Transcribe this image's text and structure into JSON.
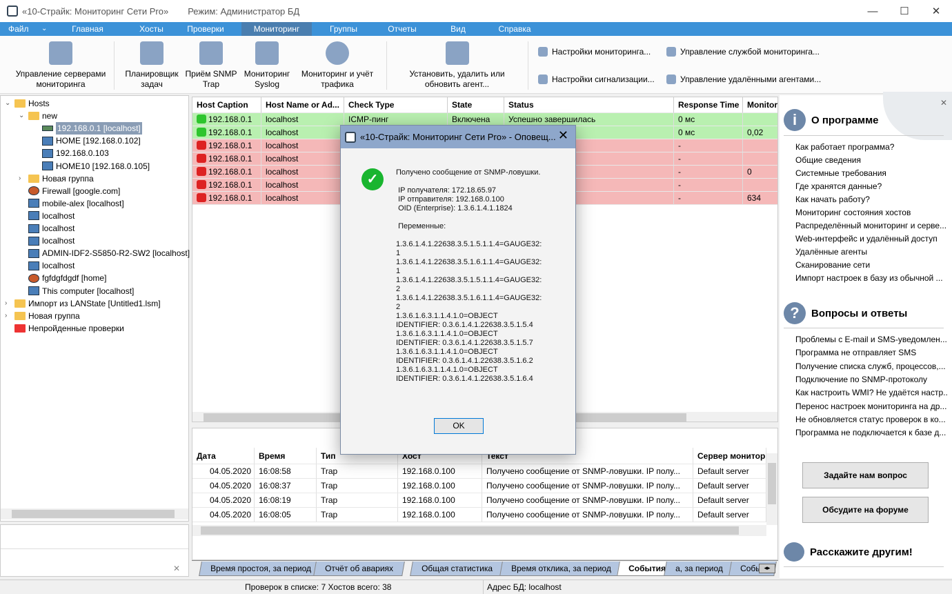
{
  "title": {
    "app": "«10-Страйк: Мониторинг Сети Pro»",
    "mode": "Режим: Администратор БД"
  },
  "menu": [
    "Файл",
    "Главная",
    "Хосты",
    "Проверки",
    "Мониторинг",
    "Группы",
    "Отчеты",
    "Вид",
    "Справка"
  ],
  "menu_active": "Мониторинг",
  "ribbon": {
    "buttons": [
      "Управление серверами мониторинга",
      "Планировщик задач",
      "Приём SNMP Trap",
      "Мониторинг Syslog",
      "Мониторинг и учёт трафика",
      "Установить, удалить или обновить агент..."
    ],
    "small": [
      "Настройки мониторинга...",
      "Настройки сигнализации...",
      "Управление службой мониторинга...",
      "Управление удалёнными агентами..."
    ]
  },
  "tree": [
    {
      "label": "Hosts",
      "level": 0,
      "icon": "folder",
      "exp": "v"
    },
    {
      "label": "new",
      "level": 1,
      "icon": "folder",
      "exp": "v"
    },
    {
      "label": "192.168.0.1 [localhost]",
      "level": 2,
      "icon": "switch",
      "selected": true
    },
    {
      "label": "HOME [192.168.0.102]",
      "level": 2,
      "icon": "computer"
    },
    {
      "label": "192.168.0.103",
      "level": 2,
      "icon": "computer"
    },
    {
      "label": "HOME10 [192.168.0.105]",
      "level": 2,
      "icon": "computer"
    },
    {
      "label": "Новая группа",
      "level": 1,
      "icon": "folder",
      "exp": ">"
    },
    {
      "label": "Firewall [google.com]",
      "level": 1,
      "icon": "firewall"
    },
    {
      "label": "mobile-alex [localhost]",
      "level": 1,
      "icon": "laptop"
    },
    {
      "label": "localhost",
      "level": 1,
      "icon": "computer"
    },
    {
      "label": "localhost",
      "level": 1,
      "icon": "computer"
    },
    {
      "label": "localhost",
      "level": 1,
      "icon": "computer"
    },
    {
      "label": "ADMIN-IDF2-S5850-R2-SW2 [localhost]",
      "level": 1,
      "icon": "computer"
    },
    {
      "label": "localhost",
      "level": 1,
      "icon": "computer"
    },
    {
      "label": "fgfdgfdgdf [home]",
      "level": 1,
      "icon": "firewall"
    },
    {
      "label": "This computer [localhost]",
      "level": 1,
      "icon": "computer"
    },
    {
      "label": "Импорт из LANState [Untitled1.lsm]",
      "level": 0,
      "icon": "folder",
      "exp": ">"
    },
    {
      "label": "Новая группа",
      "level": 0,
      "icon": "folder",
      "exp": ">"
    },
    {
      "label": "Непройденные проверки",
      "level": 0,
      "icon": "folder-red"
    }
  ],
  "grid": {
    "columns": [
      "Host Caption",
      "Host Name or Ad...",
      "Check Type",
      "State",
      "Status",
      "Response Time",
      "Monitor"
    ],
    "rows": [
      {
        "s": "ok",
        "c": [
          "192.168.0.1",
          "localhost",
          "ICMP-пинг",
          "Включена",
          "Успешно завершилась",
          "0 мс",
          ""
        ]
      },
      {
        "s": "ok",
        "c": [
          "192.168.0.1",
          "localhost",
          "",
          "",
          "шилась",
          "0 мс",
          "0,02"
        ]
      },
      {
        "s": "bad",
        "c": [
          "192.168.0.1",
          "localhost",
          "",
          "",
          "",
          "-",
          ""
        ]
      },
      {
        "s": "bad",
        "c": [
          "192.168.0.1",
          "localhost",
          "",
          "",
          "",
          "-",
          ""
        ]
      },
      {
        "s": "bad",
        "c": [
          "192.168.0.1",
          "localhost",
          "",
          "",
          "",
          "-",
          "0"
        ]
      },
      {
        "s": "bad",
        "c": [
          "192.168.0.1",
          "localhost",
          "",
          "",
          "",
          "-",
          ""
        ]
      },
      {
        "s": "bad",
        "c": [
          "192.168.0.1",
          "localhost",
          "",
          "",
          "",
          "-",
          "634"
        ]
      }
    ]
  },
  "events": {
    "columns": [
      "Дата",
      "Время",
      "Тип",
      "Хост",
      "Текст",
      "Сервер монитор."
    ],
    "rows": [
      [
        "04.05.2020",
        "16:08:58",
        "Trap",
        "192.168.0.100",
        "Получено сообщение от SNMP-ловушки.  IP полу...",
        "Default server"
      ],
      [
        "04.05.2020",
        "16:08:37",
        "Trap",
        "192.168.0.100",
        "Получено сообщение от SNMP-ловушки.  IP полу...",
        "Default server"
      ],
      [
        "04.05.2020",
        "16:08:19",
        "Trap",
        "192.168.0.100",
        "Получено сообщение от SNMP-ловушки.  IP полу...",
        "Default server"
      ],
      [
        "04.05.2020",
        "16:08:05",
        "Trap",
        "192.168.0.100",
        "Получено сообщение от SNMP-ловушки.  IP полу...",
        "Default server"
      ]
    ]
  },
  "tabs": [
    "Время простоя, за период",
    "Отчёт об авариях",
    "Общая статистика",
    "Время отклика, за период",
    "События",
    "а, за период",
    "Событ"
  ],
  "tabs_active": "События",
  "status": {
    "checks": "Проверок в списке: 7  Хостов всего: 38",
    "db": "Адрес БД: localhost"
  },
  "right": {
    "about_title": "О программе",
    "about_links": [
      "Как работает программа?",
      "Общие сведения",
      "Системные требования",
      "Где хранятся данные?",
      "Как начать работу?",
      "Мониторинг состояния хостов",
      "Распределённый мониторинг и серве...",
      "Web-интерфейс и удалённый доступ",
      "Удалённые агенты",
      "Сканирование сети",
      "Импорт настроек в базу из обычной ..."
    ],
    "faq_title": "Вопросы и ответы",
    "faq_links": [
      "Проблемы с E-mail и SMS-уведомлен...",
      "Программа не отправляет SMS",
      "Получение списка служб, процессов,...",
      "Подключение по SNMP-протоколу",
      "Как настроить WMI? Не удаётся настр...",
      "Перенос настроек мониторинга на др...",
      "Не обновляется статус проверок в ко...",
      "Программа не подключается к базе д..."
    ],
    "ask_button": "Задайте нам вопрос",
    "forum_button": "Обсудите на форуме",
    "share_title": "Расскажите другим!"
  },
  "dialog": {
    "title": "«10-Страйк: Мониторинг Сети Pro» - Оповещ...",
    "ok": "OK",
    "message": "Получено сообщение от SNMP-ловушки.\n\n IP получателя: 172.18.65.97\n IP отправителя: 192.168.0.100\n OID (Enterprise): 1.3.6.1.4.1.1824\n\n Переменные:\n\n1.3.6.1.4.1.22638.3.5.1.5.1.1.4=GAUGE32:\n1\n1.3.6.1.4.1.22638.3.5.1.6.1.1.4=GAUGE32:\n1\n1.3.6.1.4.1.22638.3.5.1.5.1.1.4=GAUGE32:\n2\n1.3.6.1.4.1.22638.3.5.1.6.1.1.4=GAUGE32:\n2\n1.3.6.1.6.3.1.1.4.1.0=OBJECT\nIDENTIFIER: 0.3.6.1.4.1.22638.3.5.1.5.4\n1.3.6.1.6.3.1.1.4.1.0=OBJECT\nIDENTIFIER: 0.3.6.1.4.1.22638.3.5.1.5.7\n1.3.6.1.6.3.1.1.4.1.0=OBJECT\nIDENTIFIER: 0.3.6.1.4.1.22638.3.5.1.6.2\n1.3.6.1.6.3.1.1.4.1.0=OBJECT\nIDENTIFIER: 0.3.6.1.4.1.22638.3.5.1.6.4"
  },
  "colors": {
    "menu": "#3c92d8",
    "menu_active": "#4a7eaf",
    "ok_row": "#b9f0b0",
    "bad_row": "#f5b8b8",
    "dialog_title": "#8ea7cb"
  }
}
